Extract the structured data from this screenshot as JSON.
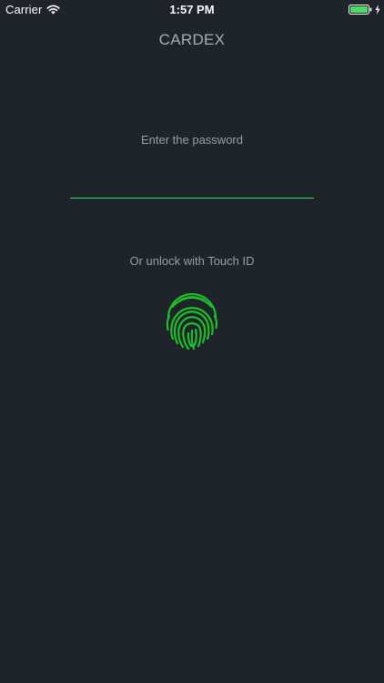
{
  "status_bar": {
    "carrier": "Carrier",
    "time": "1:57 PM",
    "battery_level": 1.0,
    "battery_color": "#4cd964",
    "charging": true
  },
  "app": {
    "title": "CARDEX"
  },
  "password": {
    "label": "Enter the password",
    "value": "",
    "underline_color": "#3fd46a"
  },
  "touch_id": {
    "label": "Or unlock with Touch ID",
    "icon": "fingerprint-icon",
    "color": "#1fbf2a"
  },
  "colors": {
    "background": "#1f232a",
    "text_muted": "#9a9ea4",
    "accent": "#3fd46a"
  }
}
